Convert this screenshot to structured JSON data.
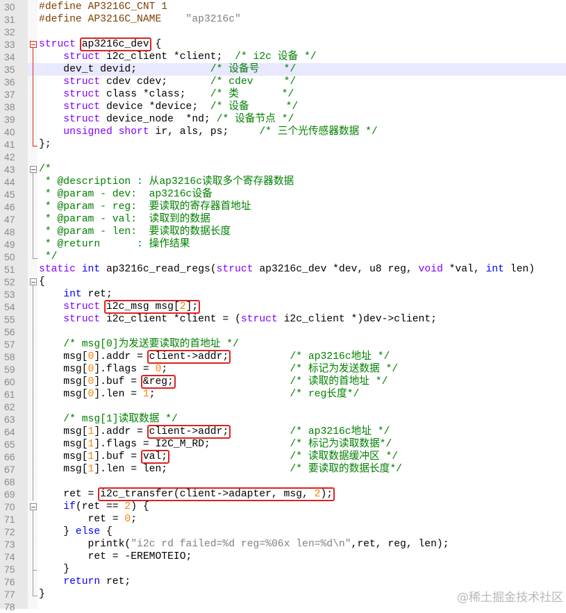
{
  "watermark": "@稀土掘金技术社区",
  "colors": {
    "keyword": "#8000ff",
    "instruction": "#0000ff",
    "comment": "#008000",
    "number": "#ff8000",
    "string": "#808080",
    "preprocessor": "#804000",
    "highlight_box": "#e02020",
    "current_line": "#e8e8ff"
  },
  "current_line": 35,
  "lines": [
    {
      "n": 30,
      "fold": "",
      "tokens": [
        {
          "c": "p",
          "t": "#define AP3216C_CNT 1"
        }
      ]
    },
    {
      "n": 31,
      "fold": "",
      "tokens": [
        {
          "c": "p",
          "t": "#define AP3216C_NAME    "
        },
        {
          "c": "s",
          "t": "\"ap3216c\""
        }
      ]
    },
    {
      "n": 32,
      "fold": "",
      "tokens": []
    },
    {
      "n": 33,
      "fold": "open-red",
      "tokens": [
        {
          "c": "k",
          "t": "struct"
        },
        {
          "t": " "
        },
        {
          "box": [
            {
              "t": "ap3216c_dev"
            }
          ]
        },
        {
          "t": " {"
        }
      ]
    },
    {
      "n": 34,
      "fold": "line-red",
      "tokens": [
        {
          "t": "    "
        },
        {
          "c": "k",
          "t": "struct"
        },
        {
          "t": " i2c_client *client;  "
        },
        {
          "c": "c",
          "t": "/* i2c 设备 */"
        }
      ]
    },
    {
      "n": 35,
      "fold": "line-red",
      "tokens": [
        {
          "t": "    dev_t devid;            "
        },
        {
          "c": "c",
          "t": "/* 设备号    */"
        }
      ]
    },
    {
      "n": 36,
      "fold": "line-red",
      "tokens": [
        {
          "t": "    "
        },
        {
          "c": "k",
          "t": "struct"
        },
        {
          "t": " cdev cdev;       "
        },
        {
          "c": "c",
          "t": "/* cdev     */"
        }
      ]
    },
    {
      "n": 37,
      "fold": "line-red",
      "tokens": [
        {
          "t": "    "
        },
        {
          "c": "k",
          "t": "struct"
        },
        {
          "t": " class *class;    "
        },
        {
          "c": "c",
          "t": "/* 类       */"
        }
      ]
    },
    {
      "n": 38,
      "fold": "line-red",
      "tokens": [
        {
          "t": "    "
        },
        {
          "c": "k",
          "t": "struct"
        },
        {
          "t": " device *device;  "
        },
        {
          "c": "c",
          "t": "/* 设备      */"
        }
      ]
    },
    {
      "n": 39,
      "fold": "line-red",
      "tokens": [
        {
          "t": "    "
        },
        {
          "c": "k",
          "t": "struct"
        },
        {
          "t": " device_node  *nd; "
        },
        {
          "c": "c",
          "t": "/* 设备节点 */"
        }
      ]
    },
    {
      "n": 40,
      "fold": "line-red",
      "tokens": [
        {
          "t": "    "
        },
        {
          "c": "k",
          "t": "unsigned"
        },
        {
          "t": " "
        },
        {
          "c": "k",
          "t": "short"
        },
        {
          "t": " ir, als, ps;     "
        },
        {
          "c": "c",
          "t": "/* 三个光传感器数据 */"
        }
      ]
    },
    {
      "n": 41,
      "fold": "end-red",
      "tokens": [
        {
          "t": "};"
        }
      ]
    },
    {
      "n": 42,
      "fold": "",
      "tokens": []
    },
    {
      "n": 43,
      "fold": "open",
      "tokens": [
        {
          "c": "c",
          "t": "/*"
        }
      ]
    },
    {
      "n": 44,
      "fold": "line",
      "tokens": [
        {
          "c": "c",
          "t": " * @description : 从ap3216c读取多个寄存器数据"
        }
      ]
    },
    {
      "n": 45,
      "fold": "line",
      "tokens": [
        {
          "c": "c",
          "t": " * @param - dev:  ap3216c设备"
        }
      ]
    },
    {
      "n": 46,
      "fold": "line",
      "tokens": [
        {
          "c": "c",
          "t": " * @param - reg:  要读取的寄存器首地址"
        }
      ]
    },
    {
      "n": 47,
      "fold": "line",
      "tokens": [
        {
          "c": "c",
          "t": " * @param - val:  读取到的数据"
        }
      ]
    },
    {
      "n": 48,
      "fold": "line",
      "tokens": [
        {
          "c": "c",
          "t": " * @param - len:  要读取的数据长度"
        }
      ]
    },
    {
      "n": 49,
      "fold": "line",
      "tokens": [
        {
          "c": "c",
          "t": " * @return      : 操作结果"
        }
      ]
    },
    {
      "n": 50,
      "fold": "end",
      "tokens": [
        {
          "c": "c",
          "t": " */"
        }
      ]
    },
    {
      "n": 51,
      "fold": "",
      "tokens": [
        {
          "c": "k",
          "t": "static"
        },
        {
          "t": " "
        },
        {
          "c": "t",
          "t": "int"
        },
        {
          "t": " ap3216c_read_regs("
        },
        {
          "c": "k",
          "t": "struct"
        },
        {
          "t": " ap3216c_dev *dev, u8 reg, "
        },
        {
          "c": "k",
          "t": "void"
        },
        {
          "t": " *val, "
        },
        {
          "c": "t",
          "t": "int"
        },
        {
          "t": " len)"
        }
      ]
    },
    {
      "n": 52,
      "fold": "open",
      "tokens": [
        {
          "t": "{"
        }
      ]
    },
    {
      "n": 53,
      "fold": "line",
      "tokens": [
        {
          "t": "    "
        },
        {
          "c": "t",
          "t": "int"
        },
        {
          "t": " ret;"
        }
      ]
    },
    {
      "n": 54,
      "fold": "line",
      "tokens": [
        {
          "t": "    "
        },
        {
          "c": "k",
          "t": "struct"
        },
        {
          "t": " "
        },
        {
          "box": [
            {
              "t": "i2c_msg msg["
            },
            {
              "c": "n",
              "t": "2"
            },
            {
              "t": "];"
            }
          ]
        }
      ]
    },
    {
      "n": 55,
      "fold": "line",
      "tokens": [
        {
          "t": "    "
        },
        {
          "c": "k",
          "t": "struct"
        },
        {
          "t": " i2c_client *client = ("
        },
        {
          "c": "k",
          "t": "struct"
        },
        {
          "t": " i2c_client *)dev->client;"
        }
      ]
    },
    {
      "n": 56,
      "fold": "line",
      "tokens": []
    },
    {
      "n": 57,
      "fold": "line",
      "tokens": [
        {
          "t": "    "
        },
        {
          "c": "c",
          "t": "/* msg[0]为发送要读取的首地址 */"
        }
      ]
    },
    {
      "n": 58,
      "fold": "line",
      "tokens": [
        {
          "t": "    msg["
        },
        {
          "c": "n",
          "t": "0"
        },
        {
          "t": "].addr = "
        },
        {
          "box": [
            {
              "t": "client->addr;"
            }
          ]
        },
        {
          "t": "          "
        },
        {
          "c": "c",
          "t": "/* ap3216c地址 */"
        }
      ]
    },
    {
      "n": 59,
      "fold": "line",
      "tokens": [
        {
          "t": "    msg["
        },
        {
          "c": "n",
          "t": "0"
        },
        {
          "t": "].flags = "
        },
        {
          "c": "n",
          "t": "0"
        },
        {
          "t": ";                    "
        },
        {
          "c": "c",
          "t": "/* 标记为发送数据 */"
        }
      ]
    },
    {
      "n": 60,
      "fold": "line",
      "tokens": [
        {
          "t": "    msg["
        },
        {
          "c": "n",
          "t": "0"
        },
        {
          "t": "].buf = "
        },
        {
          "box": [
            {
              "t": "&reg;"
            }
          ]
        },
        {
          "t": "                   "
        },
        {
          "c": "c",
          "t": "/* 读取的首地址 */"
        }
      ]
    },
    {
      "n": 61,
      "fold": "line",
      "tokens": [
        {
          "t": "    msg["
        },
        {
          "c": "n",
          "t": "0"
        },
        {
          "t": "].len = "
        },
        {
          "c": "n",
          "t": "1"
        },
        {
          "t": ";                      "
        },
        {
          "c": "c",
          "t": "/* reg长度*/"
        }
      ]
    },
    {
      "n": 62,
      "fold": "line",
      "tokens": []
    },
    {
      "n": 63,
      "fold": "line",
      "tokens": [
        {
          "t": "    "
        },
        {
          "c": "c",
          "t": "/* msg[1]读取数据 */"
        }
      ]
    },
    {
      "n": 64,
      "fold": "line",
      "tokens": [
        {
          "t": "    msg["
        },
        {
          "c": "n",
          "t": "1"
        },
        {
          "t": "].addr = "
        },
        {
          "box": [
            {
              "t": "client->addr;"
            }
          ]
        },
        {
          "t": "          "
        },
        {
          "c": "c",
          "t": "/* ap3216c地址 */"
        }
      ]
    },
    {
      "n": 65,
      "fold": "line",
      "tokens": [
        {
          "t": "    msg["
        },
        {
          "c": "n",
          "t": "1"
        },
        {
          "t": "].flags = I2C_M_RD;             "
        },
        {
          "c": "c",
          "t": "/* 标记为读取数据*/"
        }
      ]
    },
    {
      "n": 66,
      "fold": "line",
      "tokens": [
        {
          "t": "    msg["
        },
        {
          "c": "n",
          "t": "1"
        },
        {
          "t": "].buf = "
        },
        {
          "box": [
            {
              "t": "val;"
            }
          ]
        },
        {
          "t": "                    "
        },
        {
          "c": "c",
          "t": "/* 读取数据缓冲区 */"
        }
      ]
    },
    {
      "n": 67,
      "fold": "line",
      "tokens": [
        {
          "t": "    msg["
        },
        {
          "c": "n",
          "t": "1"
        },
        {
          "t": "].len = len;                    "
        },
        {
          "c": "c",
          "t": "/* 要读取的数据长度*/"
        }
      ]
    },
    {
      "n": 68,
      "fold": "line",
      "tokens": []
    },
    {
      "n": 69,
      "fold": "line",
      "tokens": [
        {
          "t": "    ret = "
        },
        {
          "box": [
            {
              "t": "i2c_transfer(client->adapter, msg, "
            },
            {
              "c": "n",
              "t": "2"
            },
            {
              "t": ");"
            }
          ]
        }
      ]
    },
    {
      "n": 70,
      "fold": "open",
      "tokens": [
        {
          "t": "    "
        },
        {
          "c": "t",
          "t": "if"
        },
        {
          "t": "(ret == "
        },
        {
          "c": "n",
          "t": "2"
        },
        {
          "t": ") {"
        }
      ]
    },
    {
      "n": 71,
      "fold": "line",
      "tokens": [
        {
          "t": "        ret = "
        },
        {
          "c": "n",
          "t": "0"
        },
        {
          "t": ";"
        }
      ]
    },
    {
      "n": 72,
      "fold": "line",
      "tokens": [
        {
          "t": "    } "
        },
        {
          "c": "t",
          "t": "else"
        },
        {
          "t": " {"
        }
      ]
    },
    {
      "n": 73,
      "fold": "line",
      "tokens": [
        {
          "t": "        printk("
        },
        {
          "c": "s",
          "t": "\"i2c rd failed=%d reg=%06x len=%d\\n\""
        },
        {
          "t": ",ret, reg, len);"
        }
      ]
    },
    {
      "n": 74,
      "fold": "line",
      "tokens": [
        {
          "t": "        ret = -EREMOTEIO;"
        }
      ]
    },
    {
      "n": 75,
      "fold": "mid",
      "tokens": [
        {
          "t": "    }"
        }
      ]
    },
    {
      "n": 76,
      "fold": "line",
      "tokens": [
        {
          "t": "    "
        },
        {
          "c": "t",
          "t": "return"
        },
        {
          "t": " ret;"
        }
      ]
    },
    {
      "n": 77,
      "fold": "end",
      "tokens": [
        {
          "t": "}"
        }
      ]
    },
    {
      "n": 78,
      "fold": "",
      "tokens": []
    }
  ]
}
